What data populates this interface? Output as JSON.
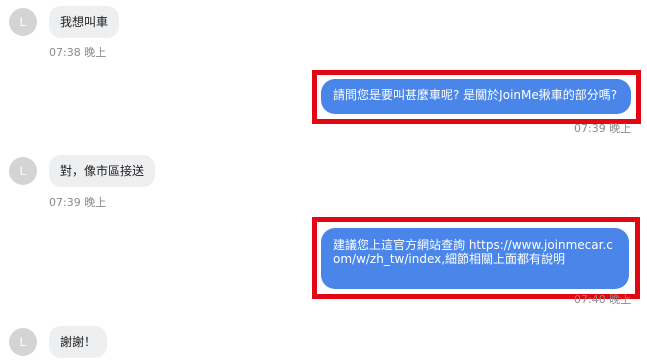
{
  "messages": [
    {
      "direction": "in",
      "avatar": "L",
      "text": "我想叫車",
      "time": "07:38 晚上"
    },
    {
      "direction": "out",
      "text": "請問您是要叫甚麼車呢? 是關於JoinMe揪車的部分嗎?",
      "time": "07:39 晚上"
    },
    {
      "direction": "in",
      "avatar": "L",
      "text": "對，像市區接送",
      "time": "07:39 晚上"
    },
    {
      "direction": "out",
      "text": "建議您上這官方網站查詢 https://www.joinmecar.com/w/zh_tw/index,細節相關上面都有說明",
      "time": "07:40 晚上"
    },
    {
      "direction": "in",
      "avatar": "L",
      "text": "謝謝！"
    }
  ],
  "colors": {
    "outgoing_bubble": "#4a86ea",
    "incoming_bubble": "#eeeff1",
    "highlight_border": "#e30613",
    "avatar_bg": "#d4d4d4"
  }
}
